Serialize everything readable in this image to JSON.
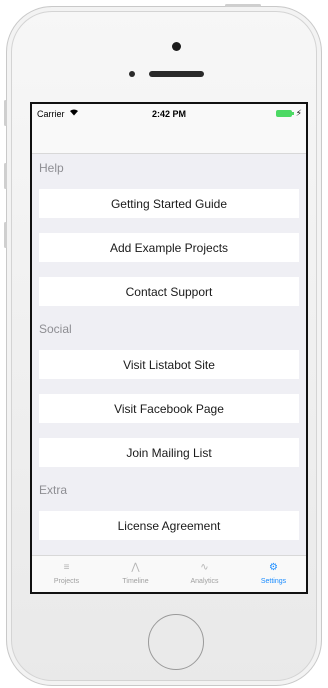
{
  "status_bar": {
    "carrier": "Carrier",
    "wifi_icon": "wifi-icon",
    "time": "2:42 PM",
    "charge_icon": "⚡"
  },
  "sections": [
    {
      "header": "Help",
      "items": [
        "Getting Started Guide",
        "Add Example Projects",
        "Contact Support"
      ]
    },
    {
      "header": "Social",
      "items": [
        "Visit Listabot Site",
        "Visit Facebook Page",
        "Join Mailing List"
      ]
    },
    {
      "header": "Extra",
      "items": [
        "License Agreement"
      ]
    }
  ],
  "tabs": [
    {
      "label": "Projects",
      "icon": "list-icon",
      "glyph": "≡"
    },
    {
      "label": "Timeline",
      "icon": "timeline-icon",
      "glyph": "⋀"
    },
    {
      "label": "Analytics",
      "icon": "analytics-icon",
      "glyph": "∿"
    },
    {
      "label": "Settings",
      "icon": "gear-icon",
      "glyph": "⚙"
    }
  ],
  "active_tab": "Settings",
  "colors": {
    "accent": "#1a8cff",
    "battery": "#4cd964",
    "section_header": "#8e8e93",
    "background": "#efeff4"
  }
}
